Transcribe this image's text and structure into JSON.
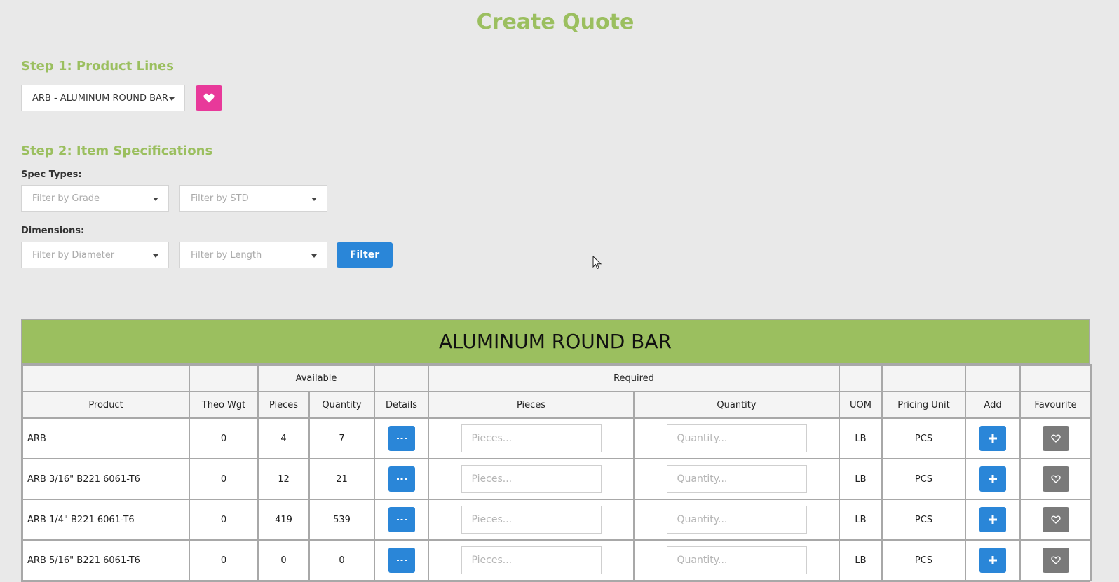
{
  "title": "Create Quote",
  "step1": {
    "label": "Step 1: Product Lines",
    "product_line": "ARB - ALUMINUM ROUND BAR"
  },
  "step2": {
    "label": "Step 2: Item Specifications",
    "spec_types_label": "Spec Types:",
    "grade_placeholder": "Filter by Grade",
    "std_placeholder": "Filter by STD",
    "dimensions_label": "Dimensions:",
    "diameter_placeholder": "Filter by Diameter",
    "length_placeholder": "Filter by Length",
    "filter_label": "Filter"
  },
  "table": {
    "title": "ALUMINUM ROUND BAR",
    "group_available": "Available",
    "group_required": "Required",
    "headers": {
      "product": "Product",
      "theo_wgt": "Theo Wgt",
      "avail_pieces": "Pieces",
      "avail_quantity": "Quantity",
      "details": "Details",
      "req_pieces": "Pieces",
      "req_quantity": "Quantity",
      "uom": "UOM",
      "pricing_unit": "Pricing Unit",
      "add": "Add",
      "favourite": "Favourite"
    },
    "pieces_placeholder": "Pieces...",
    "quantity_placeholder": "Quantity...",
    "rows": [
      {
        "product": "ARB",
        "theo_wgt": "0",
        "pieces": "4",
        "quantity": "7",
        "uom": "LB",
        "pricing_unit": "PCS"
      },
      {
        "product": "ARB 3/16\" B221 6061-T6",
        "theo_wgt": "0",
        "pieces": "12",
        "quantity": "21",
        "uom": "LB",
        "pricing_unit": "PCS"
      },
      {
        "product": "ARB 1/4\" B221 6061-T6",
        "theo_wgt": "0",
        "pieces": "419",
        "quantity": "539",
        "uom": "LB",
        "pricing_unit": "PCS"
      },
      {
        "product": "ARB 5/16\" B221 6061-T6",
        "theo_wgt": "0",
        "pieces": "0",
        "quantity": "0",
        "uom": "LB",
        "pricing_unit": "PCS"
      }
    ]
  },
  "icons": {
    "heart_color": "#e8399a",
    "accent_green": "#9bbf5f",
    "accent_blue": "#2a86d8"
  }
}
